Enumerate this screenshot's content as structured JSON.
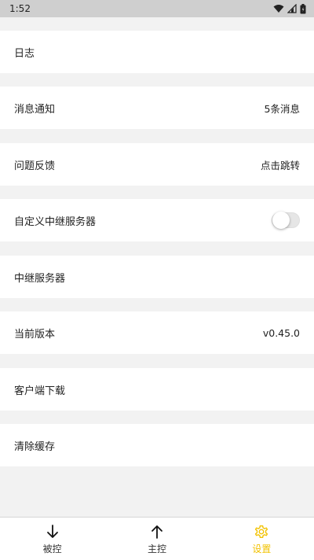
{
  "status_bar": {
    "time": "1:52"
  },
  "settings": {
    "items": [
      {
        "label": "日志",
        "value": ""
      },
      {
        "label": "消息通知",
        "value": "5条消息"
      },
      {
        "label": "问题反馈",
        "value": "点击跳转"
      },
      {
        "label": "自定义中继服务器",
        "toggle": false
      },
      {
        "label": "中继服务器",
        "value": ""
      },
      {
        "label": "当前版本",
        "value": "v0.45.0"
      },
      {
        "label": "客户端下载",
        "value": ""
      },
      {
        "label": "清除缓存",
        "value": ""
      }
    ]
  },
  "bottom_nav": {
    "items": [
      {
        "label": "被控",
        "icon": "arrow-down-icon"
      },
      {
        "label": "主控",
        "icon": "arrow-up-icon"
      },
      {
        "label": "设置",
        "icon": "gear-icon",
        "active": true
      }
    ]
  },
  "colors": {
    "accent": "#f2c200",
    "background": "#f2f2f2",
    "status_bar": "#cfcfcf"
  }
}
